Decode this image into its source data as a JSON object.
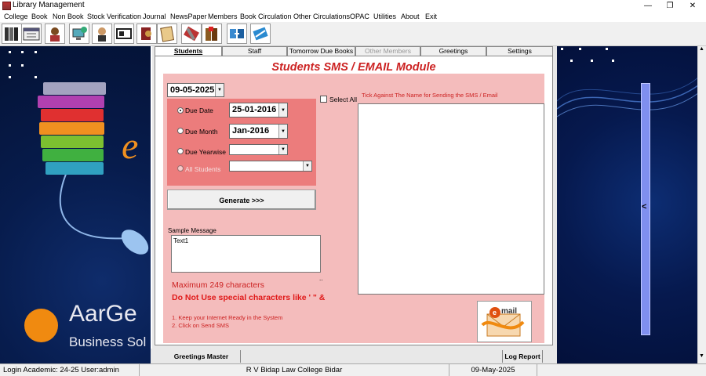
{
  "window": {
    "title": "Library Management"
  },
  "menu": [
    "College",
    "Book",
    "Non Book",
    "Stock Verification",
    "Journal",
    "NewsPaper",
    "Members",
    "Book Circulation",
    "Other Circulations",
    "OPAC",
    "Utilities",
    "About",
    "Exit"
  ],
  "tabs": [
    {
      "label": "Students"
    },
    {
      "label": "Staff"
    },
    {
      "label": "Tomorrow Due Books"
    },
    {
      "label": "Other Members"
    },
    {
      "label": "Greetings"
    },
    {
      "label": "Settings"
    }
  ],
  "module": {
    "title": "Students SMS / EMAIL Module",
    "date": "09-05-2025",
    "options": [
      {
        "label": "Due Date",
        "value": "25-01-2016",
        "selected": true
      },
      {
        "label": "Due Month",
        "value": "Jan-2016",
        "selected": false
      },
      {
        "label": "Due Yearwise",
        "value": "",
        "selected": false
      },
      {
        "label": "All Students",
        "value": "",
        "selected": false
      }
    ],
    "generate_label": "Generate >>>",
    "sample_label": "Sample Message",
    "sample_text": "Text1",
    "max_chars": "Maximum 249 characters",
    "warning": "Do Not Use special characters like  '  \"  &",
    "note1": "1. Keep your Internet Ready in the System",
    "note2": "2. Click on Send SMS",
    "select_all": "Select All",
    "tick_label": "Tick Against The Name for Sending the SMS / Email",
    "dots": ".."
  },
  "banner": {
    "company_part1": "AarGe",
    "company_part2": "Business Sol",
    "letter": "e"
  },
  "scroll_arrow": "<",
  "bottom": {
    "greetings_master": "Greetings Master",
    "log_report": "Log Report"
  },
  "status": {
    "login": "Login Academic: 24-25  User:admin",
    "college": "R V Bidap Law College Bidar",
    "date": "09-May-2025"
  },
  "email_button": {
    "icon": "email-icon"
  },
  "colors": {
    "accent_red": "#cc2222",
    "panel_pink": "#f4bcbc",
    "box_red": "#ec7c7c",
    "banner_blue": "#071c4d"
  }
}
